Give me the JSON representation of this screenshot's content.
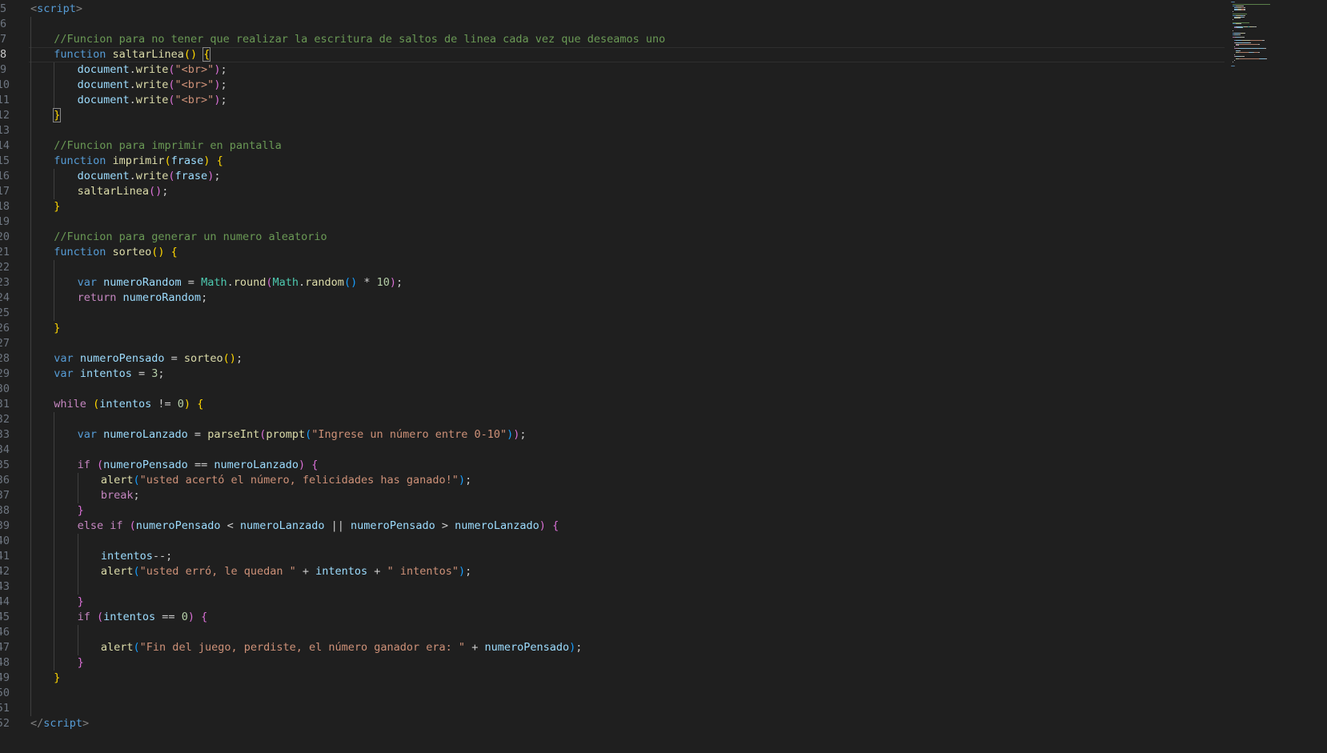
{
  "editor": {
    "language": "html",
    "current_line": 8,
    "theme_colors": {
      "background": "#1f1f1f",
      "keyword": "#569cd6",
      "control": "#c586c0",
      "function": "#dcdcaa",
      "variable": "#9cdcfe",
      "string": "#ce9178",
      "number": "#b5cea8",
      "comment": "#6a9955"
    }
  },
  "lines": [
    {
      "n": "5",
      "indent": 0,
      "tokens": [
        [
          "tag",
          "<"
        ],
        [
          "tagname",
          "script"
        ],
        [
          "tag",
          ">"
        ]
      ]
    },
    {
      "n": "6",
      "indent": 1,
      "tokens": []
    },
    {
      "n": "7",
      "indent": 1,
      "tokens": [
        [
          "cm",
          "//Funcion para no tener que realizar la escritura de saltos de linea cada vez que deseamos uno"
        ]
      ]
    },
    {
      "n": "8",
      "indent": 1,
      "tokens": [
        [
          "kw",
          "function"
        ],
        [
          "t",
          " "
        ],
        [
          "fn",
          "saltarLinea"
        ],
        [
          "p1",
          "()"
        ],
        [
          "t",
          " "
        ],
        [
          "p1 bm",
          "{"
        ]
      ]
    },
    {
      "n": "9",
      "indent": 2,
      "tokens": [
        [
          "vr",
          "document"
        ],
        [
          "t",
          "."
        ],
        [
          "fn",
          "write"
        ],
        [
          "p2",
          "("
        ],
        [
          "str",
          "\"<br>\""
        ],
        [
          "p2",
          ")"
        ],
        [
          "t",
          ";"
        ]
      ]
    },
    {
      "n": "10",
      "indent": 2,
      "tokens": [
        [
          "vr",
          "document"
        ],
        [
          "t",
          "."
        ],
        [
          "fn",
          "write"
        ],
        [
          "p2",
          "("
        ],
        [
          "str",
          "\"<br>\""
        ],
        [
          "p2",
          ")"
        ],
        [
          "t",
          ";"
        ]
      ]
    },
    {
      "n": "11",
      "indent": 2,
      "tokens": [
        [
          "vr",
          "document"
        ],
        [
          "t",
          "."
        ],
        [
          "fn",
          "write"
        ],
        [
          "p2",
          "("
        ],
        [
          "str",
          "\"<br>\""
        ],
        [
          "p2",
          ")"
        ],
        [
          "t",
          ";"
        ]
      ]
    },
    {
      "n": "12",
      "indent": 1,
      "tokens": [
        [
          "p1 bm",
          "}"
        ]
      ]
    },
    {
      "n": "13",
      "indent": 1,
      "tokens": []
    },
    {
      "n": "14",
      "indent": 1,
      "tokens": [
        [
          "cm",
          "//Funcion para imprimir en pantalla"
        ]
      ]
    },
    {
      "n": "15",
      "indent": 1,
      "tokens": [
        [
          "kw",
          "function"
        ],
        [
          "t",
          " "
        ],
        [
          "fn",
          "imprimir"
        ],
        [
          "p1",
          "("
        ],
        [
          "vr",
          "frase"
        ],
        [
          "p1",
          ")"
        ],
        [
          "t",
          " "
        ],
        [
          "p1",
          "{"
        ]
      ]
    },
    {
      "n": "16",
      "indent": 2,
      "tokens": [
        [
          "vr",
          "document"
        ],
        [
          "t",
          "."
        ],
        [
          "fn",
          "write"
        ],
        [
          "p2",
          "("
        ],
        [
          "vr",
          "frase"
        ],
        [
          "p2",
          ")"
        ],
        [
          "t",
          ";"
        ]
      ]
    },
    {
      "n": "17",
      "indent": 2,
      "tokens": [
        [
          "fn",
          "saltarLinea"
        ],
        [
          "p2",
          "()"
        ],
        [
          "t",
          ";"
        ]
      ]
    },
    {
      "n": "18",
      "indent": 1,
      "tokens": [
        [
          "p1",
          "}"
        ]
      ]
    },
    {
      "n": "19",
      "indent": 1,
      "tokens": []
    },
    {
      "n": "20",
      "indent": 1,
      "tokens": [
        [
          "cm",
          "//Funcion para generar un numero aleatorio"
        ]
      ]
    },
    {
      "n": "21",
      "indent": 1,
      "tokens": [
        [
          "kw",
          "function"
        ],
        [
          "t",
          " "
        ],
        [
          "fn",
          "sorteo"
        ],
        [
          "p1",
          "()"
        ],
        [
          "t",
          " "
        ],
        [
          "p1",
          "{"
        ]
      ]
    },
    {
      "n": "22",
      "indent": 2,
      "tokens": []
    },
    {
      "n": "23",
      "indent": 2,
      "tokens": [
        [
          "kw",
          "var"
        ],
        [
          "t",
          " "
        ],
        [
          "vr",
          "numeroRandom"
        ],
        [
          "t",
          " = "
        ],
        [
          "obj",
          "Math"
        ],
        [
          "t",
          "."
        ],
        [
          "fn",
          "round"
        ],
        [
          "p2",
          "("
        ],
        [
          "obj",
          "Math"
        ],
        [
          "t",
          "."
        ],
        [
          "fn",
          "random"
        ],
        [
          "p3",
          "()"
        ],
        [
          "t",
          " * "
        ],
        [
          "num",
          "10"
        ],
        [
          "p2",
          ")"
        ],
        [
          "t",
          ";"
        ]
      ]
    },
    {
      "n": "24",
      "indent": 2,
      "tokens": [
        [
          "ctl",
          "return"
        ],
        [
          "t",
          " "
        ],
        [
          "vr",
          "numeroRandom"
        ],
        [
          "t",
          ";"
        ]
      ]
    },
    {
      "n": "25",
      "indent": 2,
      "tokens": []
    },
    {
      "n": "26",
      "indent": 1,
      "tokens": [
        [
          "p1",
          "}"
        ]
      ]
    },
    {
      "n": "27",
      "indent": 1,
      "tokens": []
    },
    {
      "n": "28",
      "indent": 1,
      "tokens": [
        [
          "kw",
          "var"
        ],
        [
          "t",
          " "
        ],
        [
          "vr",
          "numeroPensado"
        ],
        [
          "t",
          " = "
        ],
        [
          "fn",
          "sorteo"
        ],
        [
          "p1",
          "()"
        ],
        [
          "t",
          ";"
        ]
      ]
    },
    {
      "n": "29",
      "indent": 1,
      "tokens": [
        [
          "kw",
          "var"
        ],
        [
          "t",
          " "
        ],
        [
          "vr",
          "intentos"
        ],
        [
          "t",
          " = "
        ],
        [
          "num",
          "3"
        ],
        [
          "t",
          ";"
        ]
      ]
    },
    {
      "n": "30",
      "indent": 1,
      "tokens": []
    },
    {
      "n": "31",
      "indent": 1,
      "tokens": [
        [
          "ctl",
          "while"
        ],
        [
          "t",
          " "
        ],
        [
          "p1",
          "("
        ],
        [
          "vr",
          "intentos"
        ],
        [
          "t",
          " != "
        ],
        [
          "num",
          "0"
        ],
        [
          "p1",
          ")"
        ],
        [
          "t",
          " "
        ],
        [
          "p1",
          "{"
        ]
      ]
    },
    {
      "n": "32",
      "indent": 2,
      "tokens": []
    },
    {
      "n": "33",
      "indent": 2,
      "tokens": [
        [
          "kw",
          "var"
        ],
        [
          "t",
          " "
        ],
        [
          "vr",
          "numeroLanzado"
        ],
        [
          "t",
          " = "
        ],
        [
          "fn",
          "parseInt"
        ],
        [
          "p2",
          "("
        ],
        [
          "fn",
          "prompt"
        ],
        [
          "p3",
          "("
        ],
        [
          "str",
          "\"Ingrese un número entre 0-10\""
        ],
        [
          "p3",
          ")"
        ],
        [
          "p2",
          ")"
        ],
        [
          "t",
          ";"
        ]
      ]
    },
    {
      "n": "34",
      "indent": 2,
      "tokens": []
    },
    {
      "n": "35",
      "indent": 2,
      "tokens": [
        [
          "ctl",
          "if"
        ],
        [
          "t",
          " "
        ],
        [
          "p2",
          "("
        ],
        [
          "vr",
          "numeroPensado"
        ],
        [
          "t",
          " == "
        ],
        [
          "vr",
          "numeroLanzado"
        ],
        [
          "p2",
          ")"
        ],
        [
          "t",
          " "
        ],
        [
          "p2",
          "{"
        ]
      ]
    },
    {
      "n": "36",
      "indent": 3,
      "tokens": [
        [
          "fn",
          "alert"
        ],
        [
          "p3",
          "("
        ],
        [
          "str",
          "\"usted acertó el número, felicidades has ganado!\""
        ],
        [
          "p3",
          ")"
        ],
        [
          "t",
          ";"
        ]
      ]
    },
    {
      "n": "37",
      "indent": 3,
      "tokens": [
        [
          "ctl",
          "break"
        ],
        [
          "t",
          ";"
        ]
      ]
    },
    {
      "n": "38",
      "indent": 2,
      "tokens": [
        [
          "p2",
          "}"
        ]
      ]
    },
    {
      "n": "39",
      "indent": 2,
      "tokens": [
        [
          "ctl",
          "else"
        ],
        [
          "t",
          " "
        ],
        [
          "ctl",
          "if"
        ],
        [
          "t",
          " "
        ],
        [
          "p2",
          "("
        ],
        [
          "vr",
          "numeroPensado"
        ],
        [
          "t",
          " < "
        ],
        [
          "vr",
          "numeroLanzado"
        ],
        [
          "t",
          " || "
        ],
        [
          "vr",
          "numeroPensado"
        ],
        [
          "t",
          " > "
        ],
        [
          "vr",
          "numeroLanzado"
        ],
        [
          "p2",
          ")"
        ],
        [
          "t",
          " "
        ],
        [
          "p2",
          "{"
        ]
      ]
    },
    {
      "n": "40",
      "indent": 3,
      "tokens": []
    },
    {
      "n": "41",
      "indent": 3,
      "tokens": [
        [
          "vr",
          "intentos"
        ],
        [
          "t",
          "--;"
        ]
      ]
    },
    {
      "n": "42",
      "indent": 3,
      "tokens": [
        [
          "fn",
          "alert"
        ],
        [
          "p3",
          "("
        ],
        [
          "str",
          "\"usted erró, le quedan \""
        ],
        [
          "t",
          " + "
        ],
        [
          "vr",
          "intentos"
        ],
        [
          "t",
          " + "
        ],
        [
          "str",
          "\" intentos\""
        ],
        [
          "p3",
          ")"
        ],
        [
          "t",
          ";"
        ]
      ]
    },
    {
      "n": "43",
      "indent": 3,
      "tokens": []
    },
    {
      "n": "44",
      "indent": 2,
      "tokens": [
        [
          "p2",
          "}"
        ]
      ]
    },
    {
      "n": "45",
      "indent": 2,
      "tokens": [
        [
          "ctl",
          "if"
        ],
        [
          "t",
          " "
        ],
        [
          "p2",
          "("
        ],
        [
          "vr",
          "intentos"
        ],
        [
          "t",
          " == "
        ],
        [
          "num",
          "0"
        ],
        [
          "p2",
          ")"
        ],
        [
          "t",
          " "
        ],
        [
          "p2",
          "{"
        ]
      ]
    },
    {
      "n": "46",
      "indent": 3,
      "tokens": []
    },
    {
      "n": "47",
      "indent": 3,
      "tokens": [
        [
          "fn",
          "alert"
        ],
        [
          "p3",
          "("
        ],
        [
          "str",
          "\"Fin del juego, perdiste, el número ganador era: \""
        ],
        [
          "t",
          " + "
        ],
        [
          "vr",
          "numeroPensado"
        ],
        [
          "p3",
          ")"
        ],
        [
          "t",
          ";"
        ]
      ]
    },
    {
      "n": "48",
      "indent": 2,
      "tokens": [
        [
          "p2",
          "}"
        ]
      ]
    },
    {
      "n": "49",
      "indent": 1,
      "tokens": [
        [
          "p1",
          "}"
        ]
      ]
    },
    {
      "n": "50",
      "indent": 1,
      "tokens": []
    },
    {
      "n": "51",
      "indent": 1,
      "tokens": []
    },
    {
      "n": "52",
      "indent": 0,
      "tokens": [
        [
          "tag",
          "</"
        ],
        [
          "tagname",
          "script"
        ],
        [
          "tag",
          ">"
        ]
      ]
    }
  ],
  "minimap": {
    "name": "minimap"
  }
}
